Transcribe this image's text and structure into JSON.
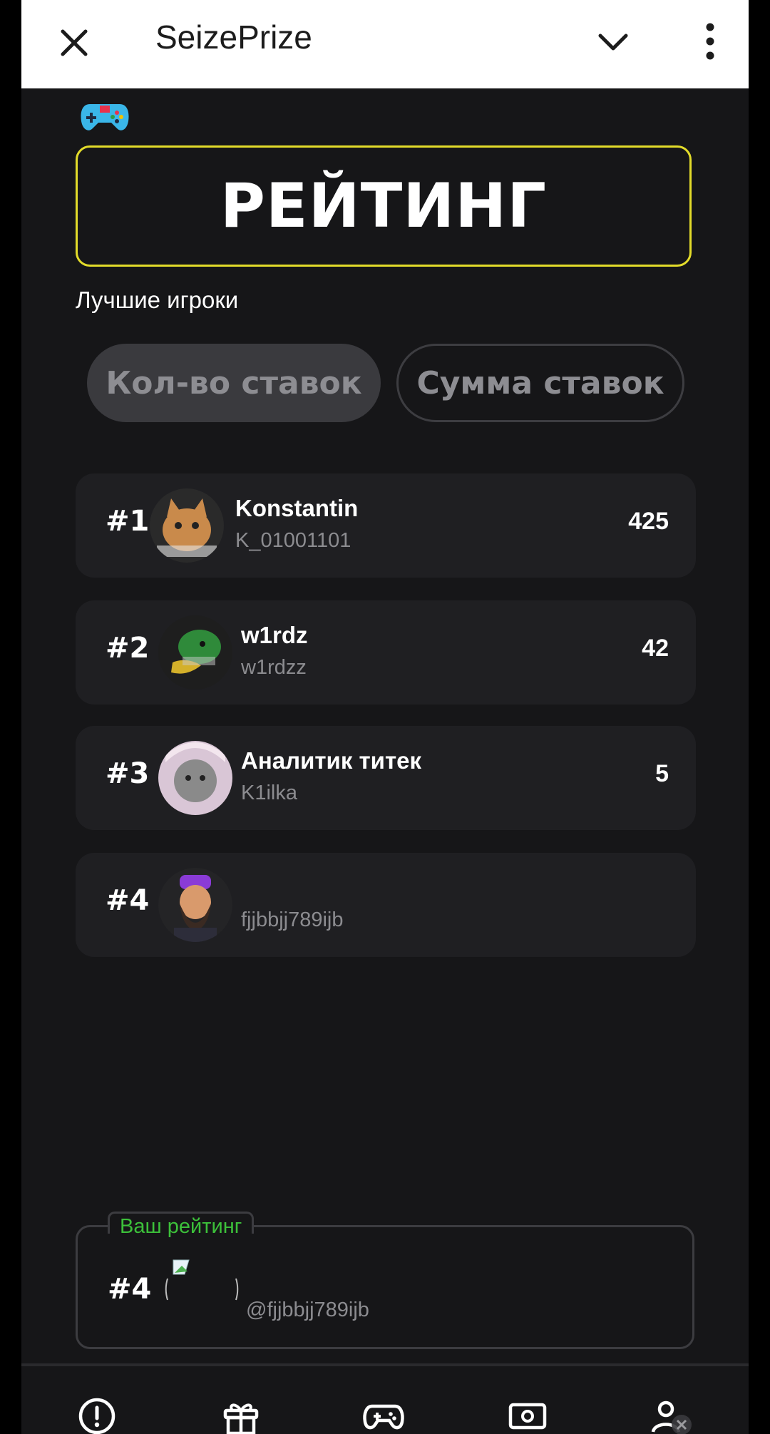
{
  "header": {
    "title": "SeizePrize"
  },
  "page": {
    "title": "РЕЙТИНГ",
    "subtitle": "Лучшие игроки"
  },
  "tabs": [
    {
      "label": "Кол-во ставок",
      "active": true
    },
    {
      "label": "Сумма ставок",
      "active": false
    }
  ],
  "leaderboard": [
    {
      "rank": "#1",
      "name": "Konstantin",
      "handle": "K_01001101",
      "score": "425"
    },
    {
      "rank": "#2",
      "name": "w1rdz",
      "handle": "w1rdzz",
      "score": "42"
    },
    {
      "rank": "#3",
      "name": "Аналитик титек",
      "handle": "K1ilka",
      "score": "5"
    },
    {
      "rank": "#4",
      "name": "",
      "handle": "fjjbbjj789ijb",
      "score": ""
    }
  ],
  "my_rating": {
    "label": "Ваш рейтинг",
    "rank": "#4",
    "handle": "@fjjbbjj789ijb"
  },
  "colors": {
    "accent_border": "#e3dc2a",
    "my_rating_label": "#3cc03a",
    "background": "#161618",
    "card": "#1f1f22"
  },
  "nav_icons": [
    "alert-icon",
    "gift-icon",
    "gamepad-icon",
    "money-icon",
    "profile-icon"
  ]
}
